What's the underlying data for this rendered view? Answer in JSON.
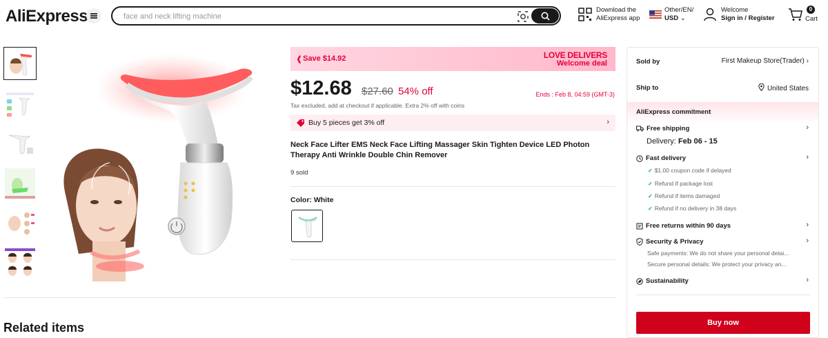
{
  "header": {
    "logo_text": "AliExpress",
    "search_placeholder": "face and neck lifting machine",
    "app_line1": "Download the",
    "app_line2": "AliExpress app",
    "locale_line1": "Other/EN/",
    "locale_line2": "USD",
    "account_line1": "Welcome",
    "account_line2": "Sign in / Register",
    "cart_count": "0",
    "cart_label": "Cart"
  },
  "promo": {
    "save_label": "Save $14.92",
    "banner_line1": "LOVE DELIVERS",
    "banner_line2": "Welcome deal"
  },
  "pricing": {
    "price": "$12.68",
    "original_price": "$27.60",
    "discount": "54% off",
    "ends": "Ends : Feb 8, 04:59 (GMT-3)",
    "tax_note": "Tax excluded, add at checkout if applicable. Extra 2% off with coins",
    "bulk_offer": "Buy 5 pieces get 3% off"
  },
  "product": {
    "title": "Neck Face Lifter EMS Neck Face Lifting Massager Skin Tighten Device LED Photon Therapy Anti Wrinkle Double Chin Remover",
    "sold": "9 sold",
    "color_label": "Color:",
    "color_value": "White"
  },
  "sidebar": {
    "sold_by_label": "Sold by",
    "sold_by_value": "First Makeup Store(Trader)",
    "ship_to_label": "Ship to",
    "ship_to_value": "United States",
    "commitment_title": "AliExpress commitment",
    "free_shipping": "Free shipping",
    "delivery_label": "Delivery:",
    "delivery_value": "Feb 06 - 15",
    "fast_delivery": "Fast delivery",
    "fast_items": [
      "$1.00 coupon code if delayed",
      "Refund if package lost",
      "Refund if items damaged",
      "Refund if no delivery in 38 days"
    ],
    "free_returns": "Free returns within 90 days",
    "security": "Security & Privacy",
    "security_line1": "Safe payments: We do not share your personal detai...",
    "security_line2": "Secure personal details: We protect your privacy an...",
    "sustainability": "Sustainability",
    "buy_now": "Buy now"
  },
  "related": {
    "title": "Related items"
  },
  "colors": {
    "accent_red": "#e3003a",
    "buy_button": "#d0021b",
    "promo_pink": "#ffc4d4"
  }
}
